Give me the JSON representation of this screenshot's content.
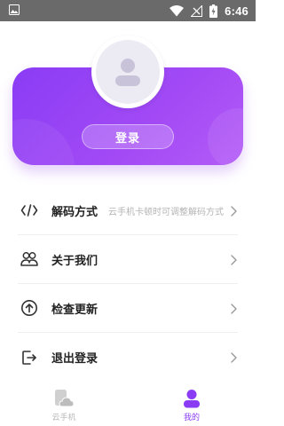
{
  "status_bar": {
    "time": "6:46",
    "icons": [
      "image-icon",
      "wifi-icon",
      "signal-off-icon",
      "battery-charging-icon"
    ]
  },
  "profile": {
    "avatar_icon": "user-icon",
    "login_label": "登录"
  },
  "menu": {
    "items": [
      {
        "icon": "code-icon",
        "label": "解码方式",
        "sub": "云手机卡顿时可调整解码方式"
      },
      {
        "icon": "people-icon",
        "label": "关于我们",
        "sub": ""
      },
      {
        "icon": "arrow-up-circle-icon",
        "label": "检查更新",
        "sub": ""
      },
      {
        "icon": "logout-icon",
        "label": "退出登录",
        "sub": ""
      }
    ]
  },
  "bottom_nav": {
    "items": [
      {
        "icon": "cloud-phone-icon",
        "label": "云手机",
        "active": false
      },
      {
        "icon": "user-icon",
        "label": "我的",
        "active": true
      }
    ]
  },
  "colors": {
    "accent": "#8a3cf5",
    "card_gradient_end": "#b45cf7",
    "inactive": "#b8b8b8",
    "status_bar": "#6a6a6a"
  }
}
